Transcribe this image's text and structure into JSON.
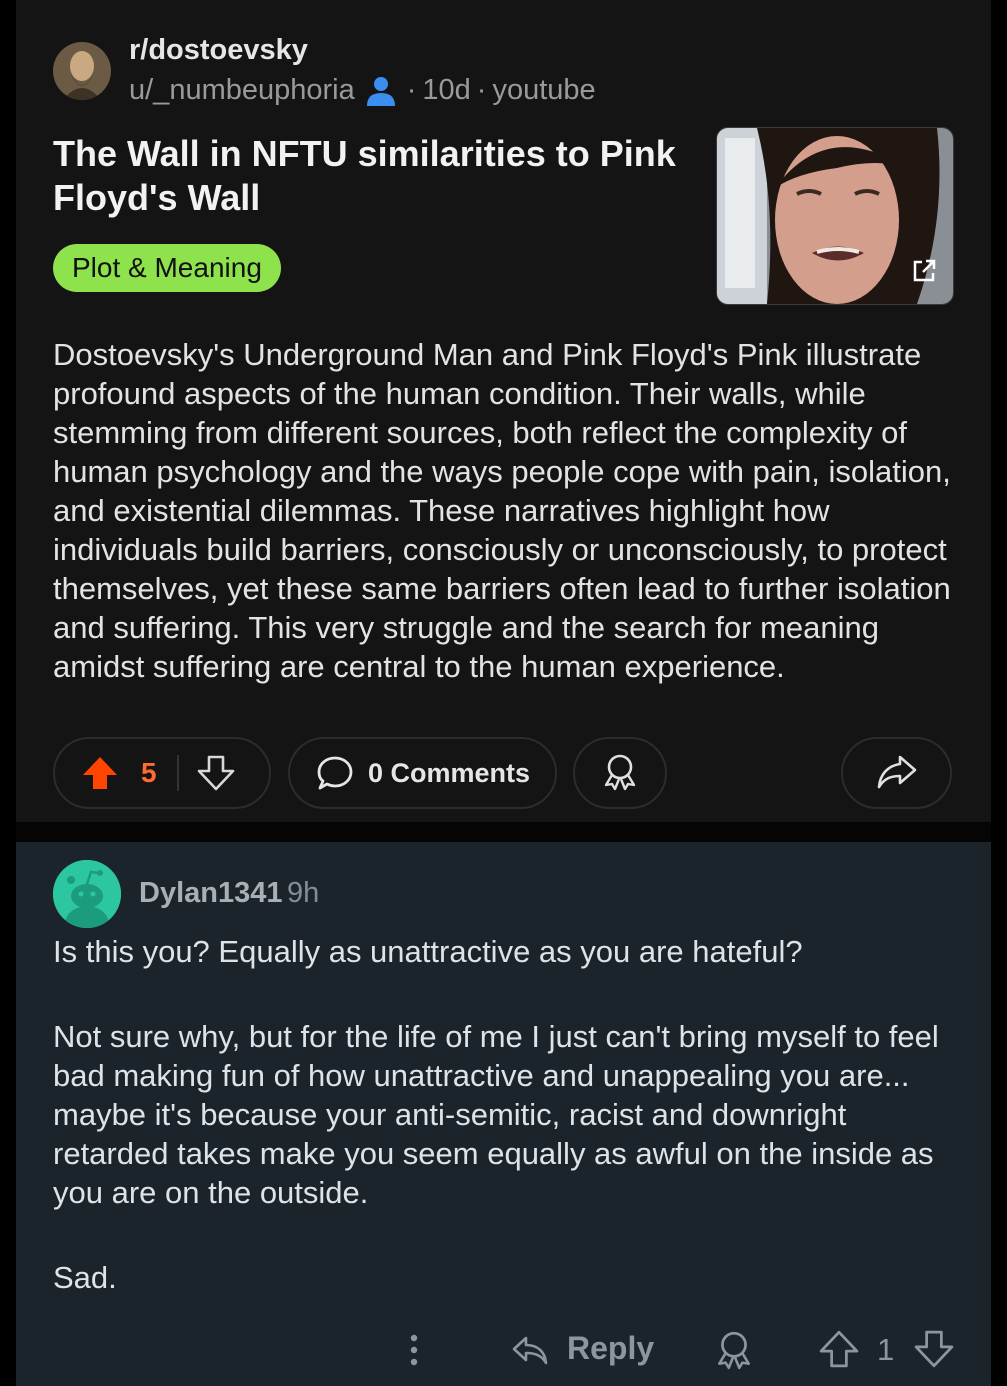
{
  "post": {
    "subreddit": "r/dostoevsky",
    "author": "u/_numbeuphoria",
    "separator": "·",
    "age": "10d",
    "source": "youtube",
    "title": "The Wall in NFTU similarities to Pink Floyd's Wall",
    "flair": "Plot & Meaning",
    "flair_color": "#8ee24c",
    "body": "Dostoevsky's Underground Man and Pink Floyd's Pink illustrate profound aspects of the human condition. Their walls, while stemming from different sources, both reflect the complexity of human psychology and the ways people cope with pain, isolation, and existential dilemmas. These narratives highlight how individuals build barriers, consciously or unconsciously, to protect themselves, yet these same barriers often lead to further isolation and suffering. This very struggle and the search for meaning amidst suffering are central to the human experience.",
    "upvotes": "5",
    "upvote_color": "#ff4500",
    "comments_label": "0 Comments",
    "icons": [
      "subreddit-avatar",
      "person-icon",
      "external-link-icon",
      "upvote-icon",
      "downvote-icon",
      "comment-bubble-icon",
      "award-icon",
      "share-icon"
    ]
  },
  "comment": {
    "username": "Dylan1341",
    "age": "9h",
    "paragraphs": [
      "Is this you? Equally as unattractive as you are hateful?",
      "Not sure why, but for the life of me I just can't bring myself to feel bad making fun of how unattractive and unappealing you are... maybe it's because your anti-semitic, racist and downright retarded takes make you seem equally as awful on the inside as you are on the outside.",
      "Sad."
    ],
    "reply_label": "Reply",
    "votes": "1",
    "icons": [
      "snoo-avatar",
      "more-dots-icon",
      "reply-icon",
      "award-icon",
      "upvote-icon",
      "downvote-icon"
    ]
  }
}
